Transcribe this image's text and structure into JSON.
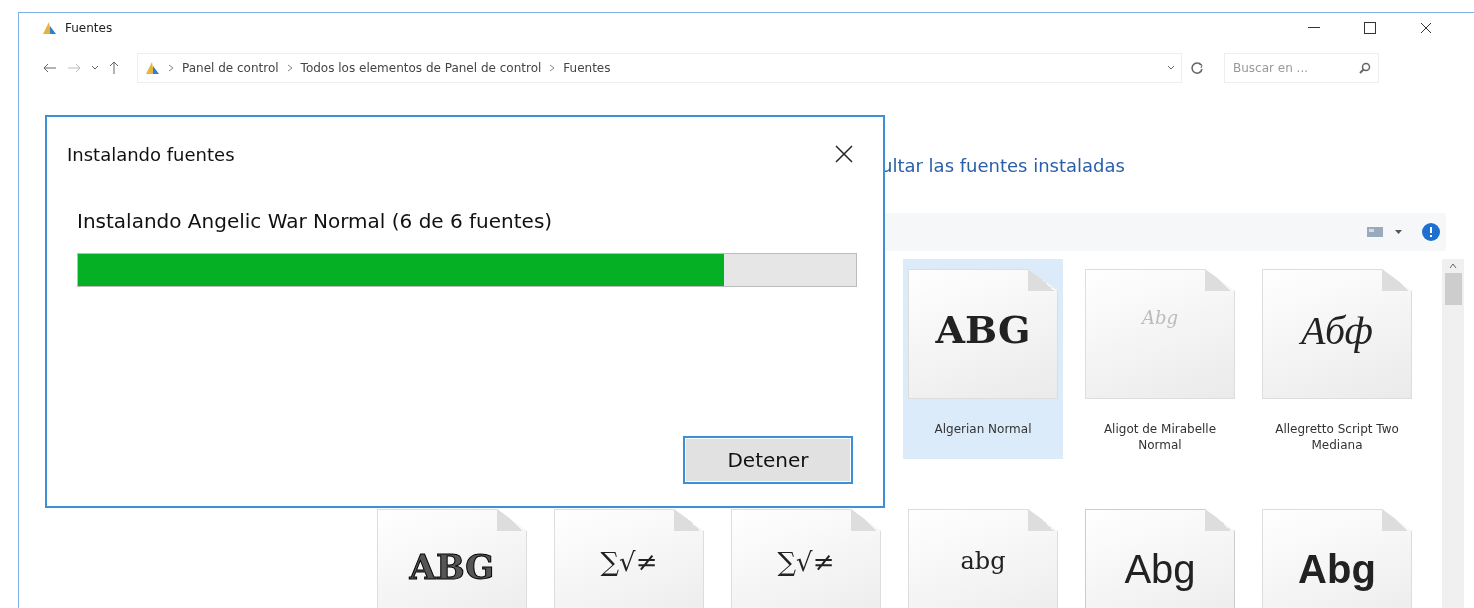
{
  "window": {
    "title": "Fuentes"
  },
  "address": {
    "segments": [
      "Panel de control",
      "Todos los elementos de Panel de control",
      "Fuentes"
    ]
  },
  "search": {
    "placeholder": "Buscar en ..."
  },
  "link": "ultar las fuentes instaladas",
  "fonts_row_1": [
    {
      "sample": "ABG",
      "kind": "blackletter",
      "label": "Algerian Normal",
      "selected": true
    },
    {
      "sample": "Abg",
      "kind": "faint",
      "label": "Aligot de Mirabelle Normal",
      "selected": false
    },
    {
      "sample": "Абф",
      "kind": "script",
      "label": "Allegretto Script Two Mediana",
      "selected": false
    }
  ],
  "fonts_row_2": [
    {
      "sample": "ABG",
      "kind": "outline",
      "stacked": false
    },
    {
      "sample": "∑√≠",
      "kind": "symbol",
      "stacked": false
    },
    {
      "sample": "∑√≠",
      "kind": "symbol",
      "stacked": false
    },
    {
      "sample": "abg",
      "kind": "serif",
      "stacked": false
    },
    {
      "sample": "Abg",
      "kind": "sans",
      "stacked": true
    },
    {
      "sample": "Abg",
      "kind": "bold",
      "stacked": false
    }
  ],
  "dialog": {
    "title": "Instalando fuentes",
    "message": "Instalando Angelic War Normal (6 de 6 fuentes)",
    "progress": {
      "level": 0.83
    },
    "button": "Detener"
  }
}
